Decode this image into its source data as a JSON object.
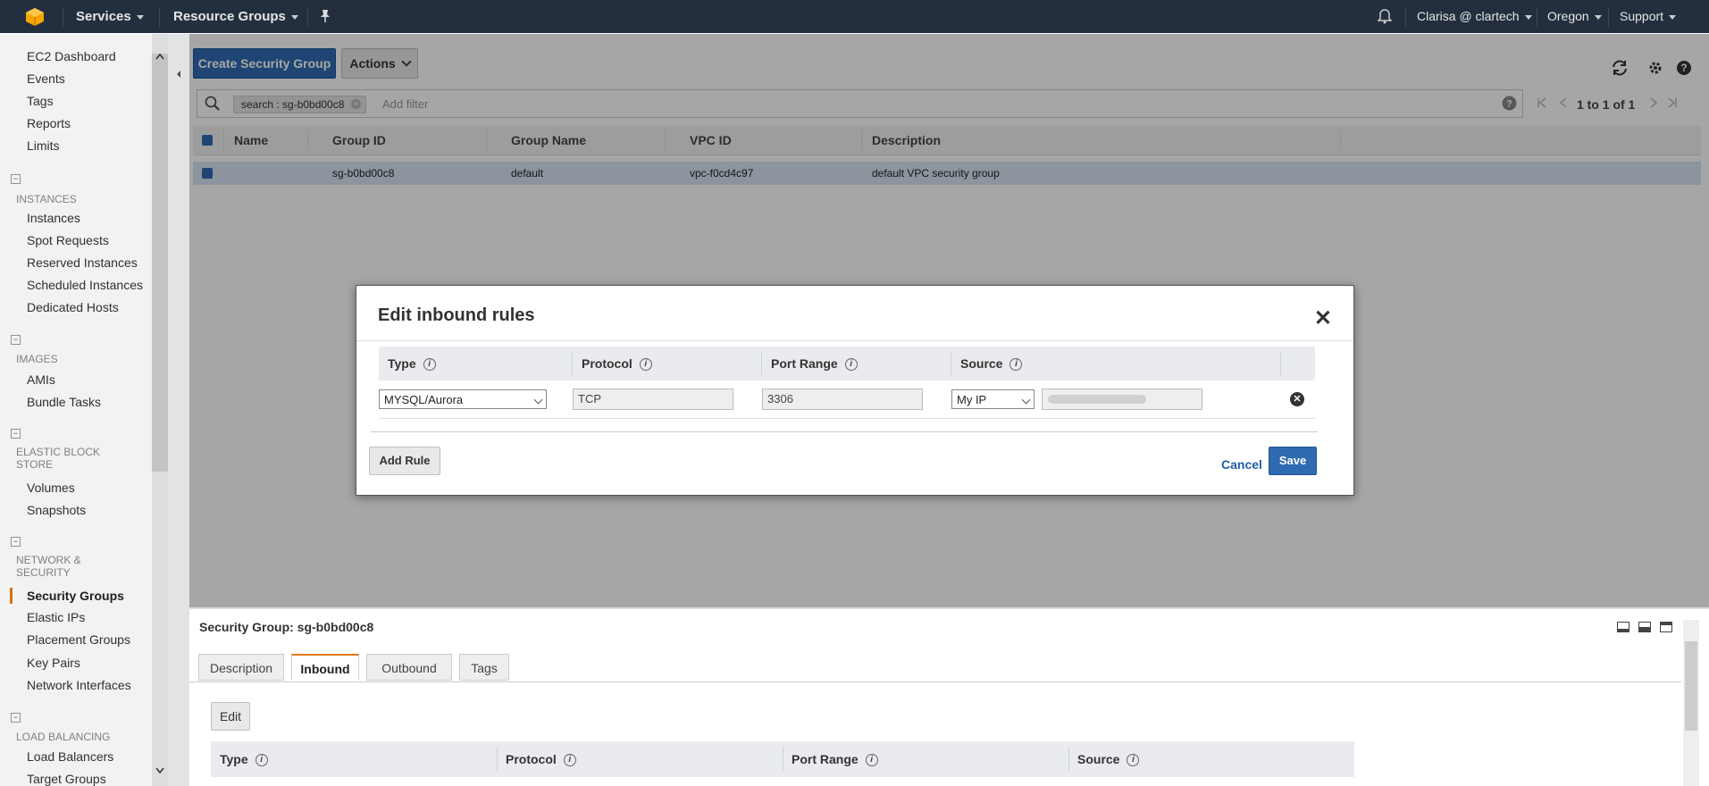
{
  "topbar": {
    "services": "Services",
    "resource_groups": "Resource Groups",
    "user": "Clarisa @ clartech",
    "region": "Oregon",
    "support": "Support"
  },
  "sidebar": {
    "items_top": [
      "EC2 Dashboard",
      "Events",
      "Tags",
      "Reports",
      "Limits"
    ],
    "section_instances": "INSTANCES",
    "instances": [
      "Instances",
      "Spot Requests",
      "Reserved Instances",
      "Scheduled Instances",
      "Dedicated Hosts"
    ],
    "section_images": "IMAGES",
    "images": [
      "AMIs",
      "Bundle Tasks"
    ],
    "section_ebs": "ELASTIC BLOCK STORE",
    "ebs": [
      "Volumes",
      "Snapshots"
    ],
    "section_network": "NETWORK & SECURITY",
    "network": [
      "Security Groups",
      "Elastic IPs",
      "Placement Groups",
      "Key Pairs",
      "Network Interfaces"
    ],
    "section_lb": "LOAD BALANCING",
    "lb": [
      "Load Balancers",
      "Target Groups"
    ]
  },
  "toolbar": {
    "create_label": "Create Security Group",
    "actions_label": "Actions"
  },
  "search": {
    "chip": "search : sg-b0bd00c8",
    "placeholder": "Add filter",
    "pagination": "1 to 1 of 1"
  },
  "grid": {
    "columns": [
      "Name",
      "Group ID",
      "Group Name",
      "VPC ID",
      "Description"
    ],
    "rows": [
      {
        "name": "",
        "group_id": "sg-b0bd00c8",
        "group_name": "default",
        "vpc_id": "vpc-f0cd4c97",
        "description": "default VPC security group"
      }
    ]
  },
  "modal": {
    "title": "Edit inbound rules",
    "columns": [
      "Type",
      "Protocol",
      "Port Range",
      "Source"
    ],
    "rule": {
      "type": "MYSQL/Aurora",
      "protocol": "TCP",
      "port_range": "3306",
      "source_type": "My IP"
    },
    "add_rule": "Add Rule",
    "cancel": "Cancel",
    "save": "Save"
  },
  "details": {
    "title": "Security Group: sg-b0bd00c8",
    "tabs": [
      "Description",
      "Inbound",
      "Outbound",
      "Tags"
    ],
    "active_tab": "Inbound",
    "edit_label": "Edit",
    "columns": [
      "Type",
      "Protocol",
      "Port Range",
      "Source"
    ]
  },
  "colors": {
    "accent": "#2e6bb1",
    "topbar": "#232f3e",
    "active_marker": "#e47911"
  }
}
